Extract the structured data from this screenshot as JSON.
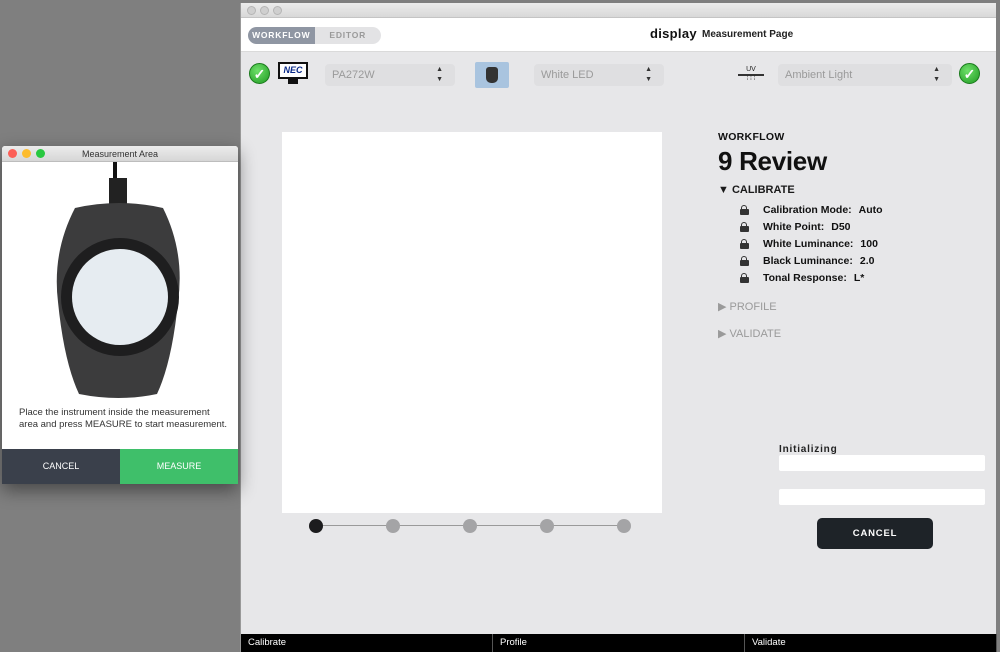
{
  "main": {
    "tabs": [
      "WORKFLOW",
      "EDITOR"
    ],
    "title": "display",
    "subtitle": "Measurement Page",
    "display_select": "PA272W",
    "illuminant_select": "White LED",
    "uv_label": "UV",
    "ambient_select": "Ambient Light",
    "brand": "NEC",
    "workflow_label": "WORKFLOW",
    "workflow_title": "9 Review",
    "calibrate_section": "▼ CALIBRATE",
    "settings": [
      {
        "label": "Calibration Mode:",
        "value": "Auto"
      },
      {
        "label": "White Point:",
        "value": "D50"
      },
      {
        "label": "White Luminance:",
        "value": "100"
      },
      {
        "label": "Black Luminance:",
        "value": "2.0"
      },
      {
        "label": "Tonal Response:",
        "value": "L*"
      }
    ],
    "profile_section": "▶ PROFILE",
    "validate_section": "▶ VALIDATE",
    "status_label": "Initializing",
    "cancel_label": "CANCEL",
    "footer": [
      "Calibrate",
      "Profile",
      "Validate"
    ],
    "step_count": 5,
    "active_step": 1
  },
  "dialog": {
    "title": "Measurement Area",
    "message": "Place the instrument inside the measurement area and press MEASURE to start measurement.",
    "cancel_label": "CANCEL",
    "measure_label": "MEASURE"
  },
  "colors": {
    "accent_green": "#3fbf6a",
    "dark_button": "#1e2328",
    "tab_active": "#8f96a3"
  }
}
